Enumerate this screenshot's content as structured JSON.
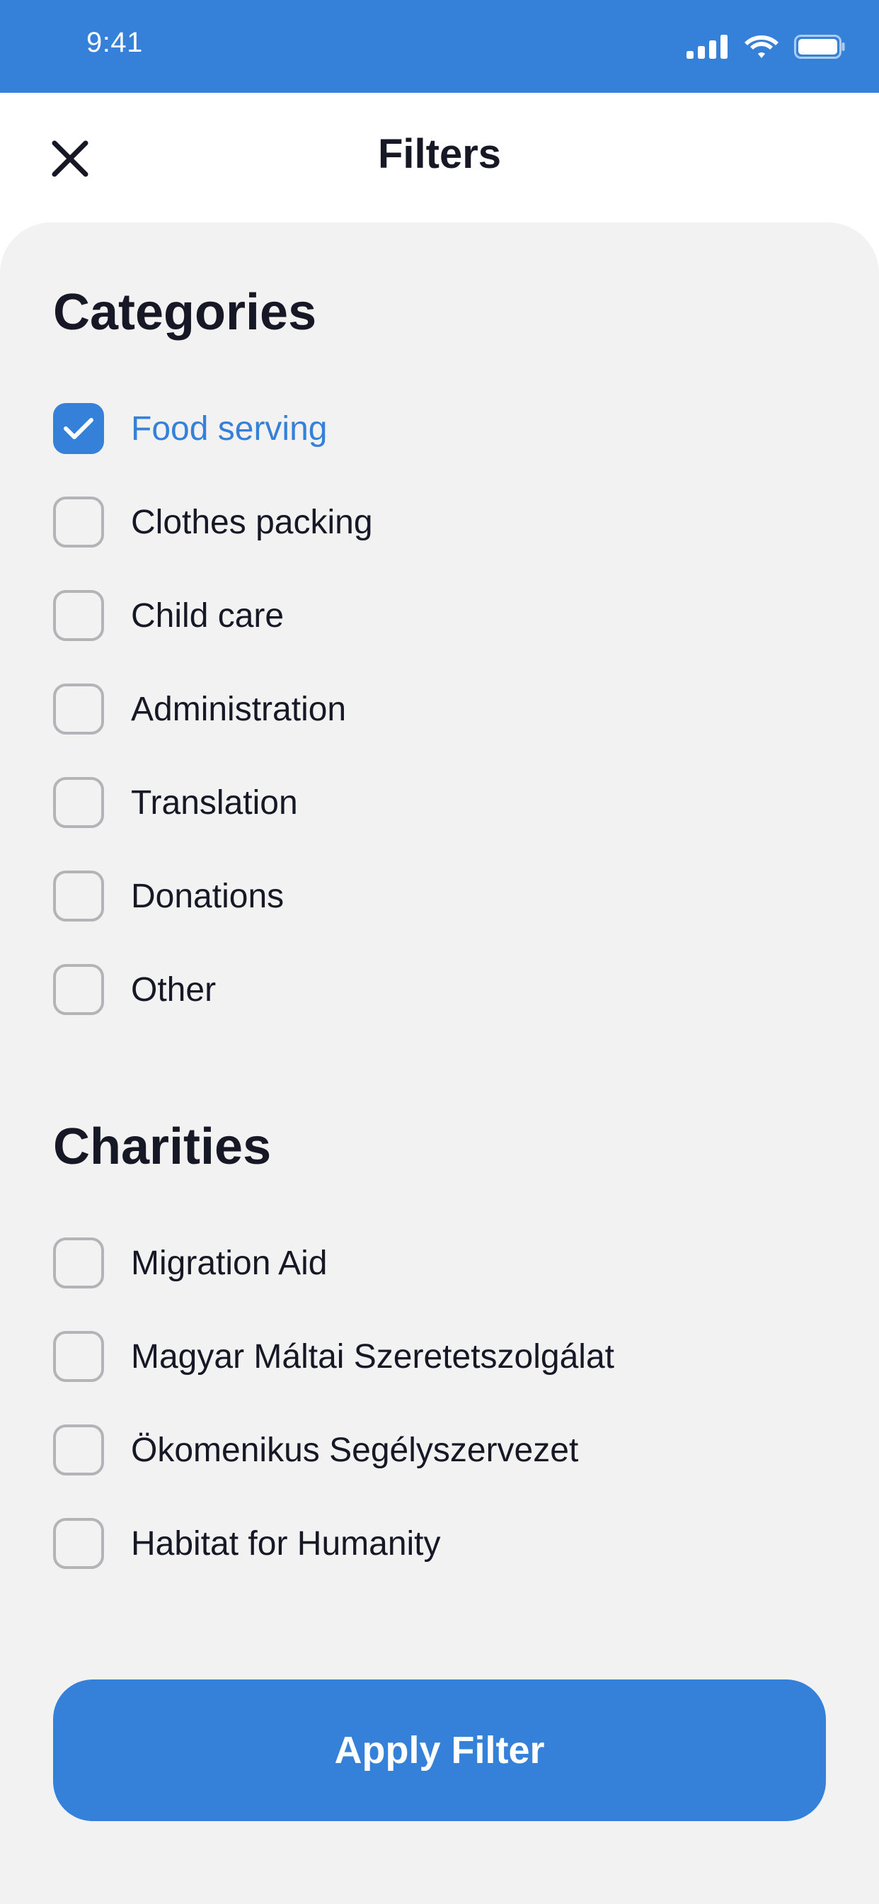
{
  "status_bar": {
    "time": "9:41",
    "icons": [
      "signal-icon",
      "wifi-icon",
      "battery-icon"
    ]
  },
  "header": {
    "title": "Filters",
    "close_icon": "close-icon"
  },
  "categories": {
    "title": "Categories",
    "options": [
      {
        "label": "Food serving",
        "checked": true
      },
      {
        "label": "Clothes packing",
        "checked": false
      },
      {
        "label": "Child care",
        "checked": false
      },
      {
        "label": "Administration",
        "checked": false
      },
      {
        "label": "Translation",
        "checked": false
      },
      {
        "label": "Donations",
        "checked": false
      },
      {
        "label": "Other",
        "checked": false
      }
    ]
  },
  "charities": {
    "title": "Charities",
    "options": [
      {
        "label": "Migration Aid",
        "checked": false
      },
      {
        "label": "Magyar Máltai Szeretetszolgálat",
        "checked": false
      },
      {
        "label": "Ökomenikus Segélyszervezet",
        "checked": false
      },
      {
        "label": "Habitat for Humanity",
        "checked": false
      }
    ]
  },
  "apply_button": {
    "label": "Apply Filter"
  },
  "colors": {
    "accent": "#3580d9",
    "text": "#171826",
    "background": "#f2f2f3",
    "checkbox_border": "#b4b4b8"
  }
}
